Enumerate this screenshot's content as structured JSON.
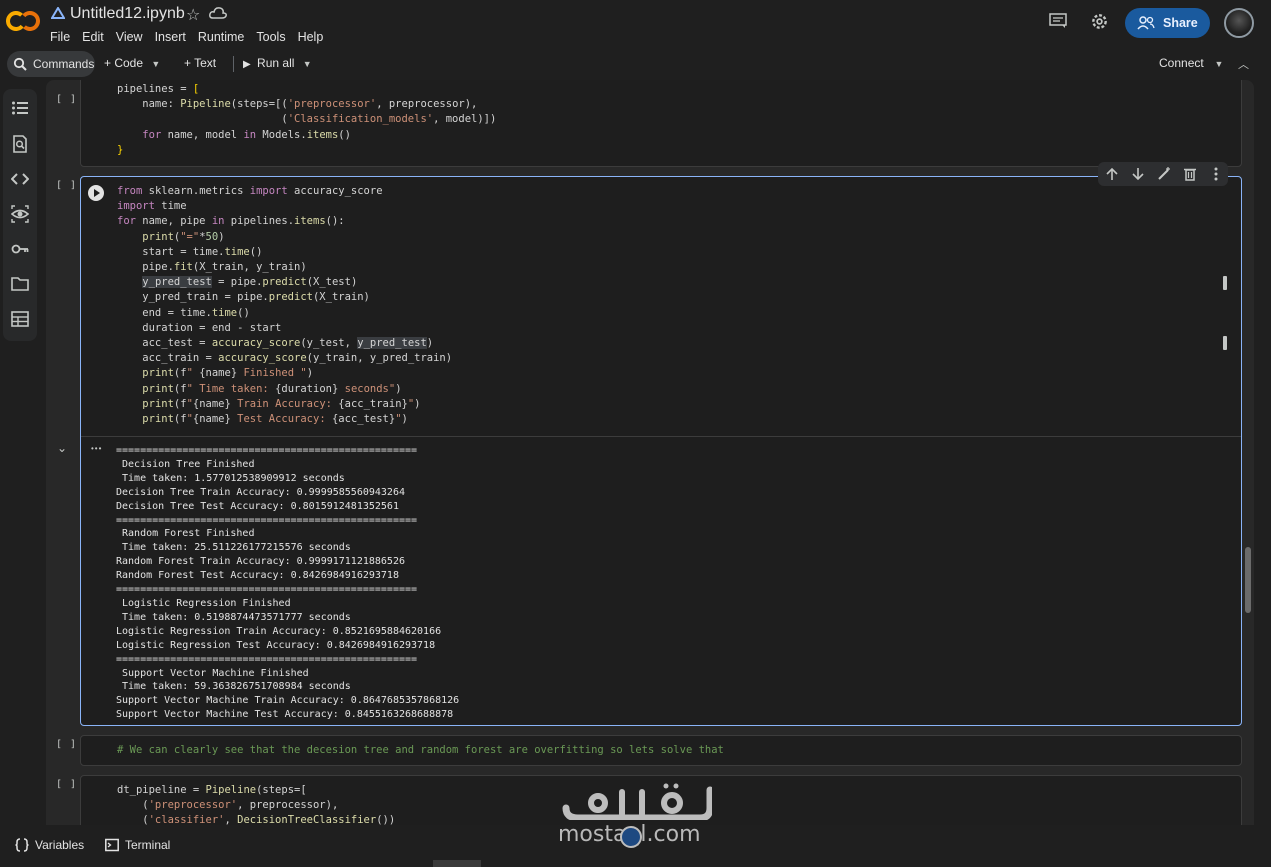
{
  "header": {
    "notebook_title": "Untitled12.ipynb",
    "menu": [
      "File",
      "Edit",
      "View",
      "Insert",
      "Runtime",
      "Tools",
      "Help"
    ],
    "share_label": "Share"
  },
  "toolbar": {
    "commands_label": "Commands",
    "code_label": "+ Code",
    "text_label": "+ Text",
    "run_all_label": "Run all",
    "connect_label": "Connect"
  },
  "cells": {
    "c1_bracket": "[ ]",
    "c2_bracket": "[ ]",
    "c3_bracket": "[ ]",
    "c4_bracket": "[ ]",
    "output_ellipsis": "•••"
  },
  "output_lines": [
    "==================================================",
    " Decision Tree Finished ",
    " Time taken: 1.577012538909912 seconds",
    "Decision Tree Train Accuracy: 0.9999585560943264",
    "Decision Tree Test Accuracy: 0.8015912481352561",
    "==================================================",
    " Random Forest Finished ",
    " Time taken: 25.511226177215576 seconds",
    "Random Forest Train Accuracy: 0.9999171121886526",
    "Random Forest Test Accuracy: 0.8426984916293718",
    "==================================================",
    " Logistic Regression Finished ",
    " Time taken: 0.5198874473571777 seconds",
    "Logistic Regression Train Accuracy: 0.8521695884620166",
    "Logistic Regression Test Accuracy: 0.8426984916293718",
    "==================================================",
    " Support Vector Machine Finished ",
    " Time taken: 59.363826751708984 seconds",
    "Support Vector Machine Train Accuracy: 0.8647685357868126",
    "Support Vector Machine Test Accuracy: 0.8455163268688878"
  ],
  "comment_cell": "# We can clearly see that the decesion tree and random forest are overfitting so lets solve that",
  "footer": {
    "variables_label": "Variables",
    "terminal_label": "Terminal"
  },
  "watermark": {
    "latin": "mostaql.com"
  },
  "colors": {
    "accent": "#8ab4f8",
    "share_bg": "#1a5a9e",
    "bg": "#1f1f1f"
  },
  "icons": [
    "colab-logo",
    "drive-icon",
    "star-icon",
    "cloud-icon",
    "comment-icon",
    "gear-icon",
    "share-people-icon",
    "search-icon",
    "play-icon",
    "toc-icon",
    "find-icon",
    "code-icon",
    "variables-eye-icon",
    "key-icon",
    "folder-icon",
    "table-icon",
    "arrow-up-icon",
    "arrow-down-icon",
    "edit-icon",
    "trash-icon",
    "more-vert-icon",
    "chevron-down-icon",
    "terminal-icon"
  ]
}
